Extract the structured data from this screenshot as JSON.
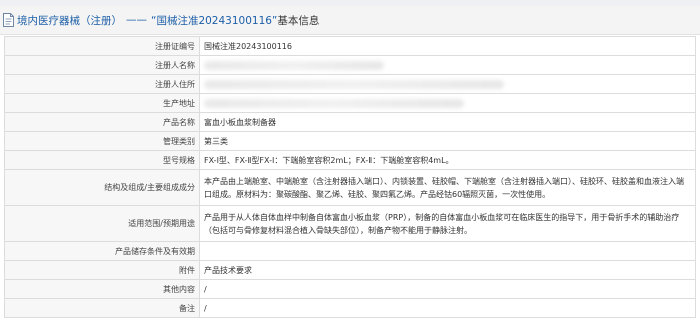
{
  "header": {
    "category": "境内医疗器械（注册）",
    "dash": "——",
    "title": "“国械注准20243100116”",
    "suffix": "基本信息",
    "icon": "document-icon"
  },
  "rows": [
    {
      "label": "注册证编号",
      "value": "国械注准20243100116"
    },
    {
      "label": "注册人名称",
      "value": ""
    },
    {
      "label": "注册人住所",
      "value": ""
    },
    {
      "label": "生产地址",
      "value": ""
    },
    {
      "label": "产品名称",
      "value": "富血小板血浆制备器"
    },
    {
      "label": "管理类别",
      "value": "第三类"
    },
    {
      "label": "型号规格",
      "value": "FX-Ⅰ型、FX-Ⅱ型FX-Ⅰ：下端舱室容积2mL；FX-Ⅱ：下端舱室容积4mL。"
    },
    {
      "label": "结构及组成/主要组成成分",
      "value": "本产品由上端舱室、中端舱室（含注射器插入端口）、内锁装置、硅胶帽、下端舱室（含注射器插入端口）、硅胶环、硅胶盖和血液注入端口组成。原材料为：聚碳酸酯、聚乙烯、硅胶、聚四氟乙烯。产品经钴60辐照灭菌，一次性使用。"
    },
    {
      "label": "适用范围/预期用途",
      "value": "产品用于从人体自体血样中制备自体富血小板血浆（PRP），制备的自体富血小板血浆可在临床医生的指导下，用于骨折手术的辅助治疗（包括可与骨修复材料混合植入骨缺失部位），制备产物不能用于静脉注射。"
    },
    {
      "label": "产品储存条件及有效期",
      "value": ""
    },
    {
      "label": "附件",
      "value": "产品技术要求"
    },
    {
      "label": "其他内容",
      "value": "/"
    },
    {
      "label": "备注",
      "value": "/"
    }
  ]
}
